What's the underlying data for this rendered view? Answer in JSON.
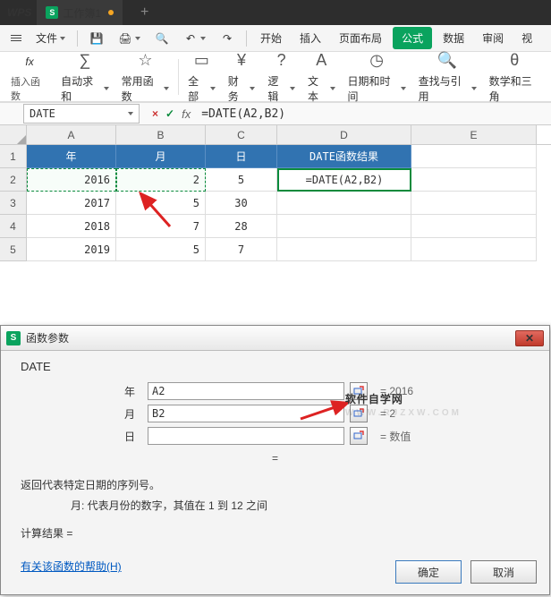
{
  "titlebar": {
    "app": "WPS",
    "tab": "工作簿1",
    "plus": "+"
  },
  "menu": {
    "file": "文件",
    "start": "开始",
    "insert": "插入",
    "layout": "页面布局",
    "formula": "公式",
    "data": "数据",
    "review": "审阅",
    "vi": "视"
  },
  "ribbon": {
    "insertfn": "插入函数",
    "autosum": "自动求和",
    "common": "常用函数",
    "all": "全部",
    "finance": "财务",
    "logic": "逻辑",
    "text": "文本",
    "datetime": "日期和时间",
    "lookup": "查找与引用",
    "math": "数学和三角"
  },
  "namebox": "DATE",
  "formula_bar": "=DATE(A2,B2)",
  "cols": {
    "A": "A",
    "B": "B",
    "C": "C",
    "D": "D",
    "E": "E"
  },
  "colw": {
    "A": 100,
    "B": 100,
    "C": 80,
    "D": 150,
    "E": 140
  },
  "headers": {
    "year": "年",
    "month": "月",
    "day": "日",
    "result": "DATE函数结果"
  },
  "rows": [
    {
      "y": "2016",
      "m": "2",
      "d": "5",
      "r": "=DATE(A2,B2)"
    },
    {
      "y": "2017",
      "m": "5",
      "d": "30",
      "r": ""
    },
    {
      "y": "2018",
      "m": "7",
      "d": "28",
      "r": ""
    },
    {
      "y": "2019",
      "m": "5",
      "d": "7",
      "r": ""
    }
  ],
  "dialog": {
    "title": "函数参数",
    "fn": "DATE",
    "params": [
      {
        "label": "年",
        "value": "A2",
        "result": "= 2016"
      },
      {
        "label": "月",
        "value": "B2",
        "result": "= 2"
      },
      {
        "label": "日",
        "value": "",
        "result": "= 数值"
      }
    ],
    "eq": "=",
    "desc1": "返回代表特定日期的序列号。",
    "desc2": "月:   代表月份的数字，其值在 1 到 12 之间",
    "calc": "计算结果 =",
    "help": "有关该函数的帮助(H)",
    "ok": "确定",
    "cancel": "取消"
  },
  "wm": {
    "t1": "软件自学网",
    "t2": "WWW.RJZXW.COM"
  }
}
